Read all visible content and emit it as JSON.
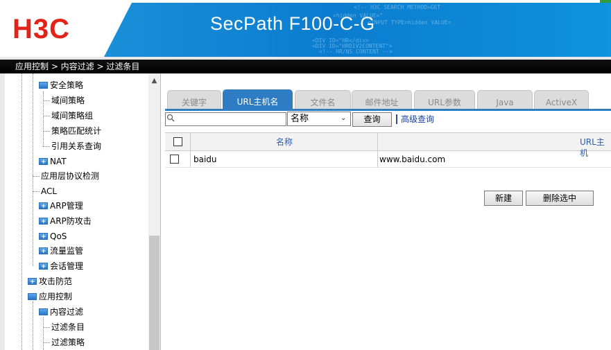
{
  "header": {
    "logo": "H3C",
    "product_title": "SecPath F100-C-G",
    "banner_code": [
      "<!-- H3C SEARCH METHOD=GET",
      "=hidden VALUE=\"",
      "<INPUT TYPE=hidden VALUE=",
      "<DIV ID=\"HR</div>",
      "<DIV ID=\"HRDIV2CONTENT\">",
      "<!-- HR/NS CONTENT -->"
    ]
  },
  "breadcrumb": "应用控制 > 内容过滤 > 过滤条目",
  "sidebar": {
    "items": [
      {
        "label": "安全策略",
        "icon": "folder-open-icon"
      },
      {
        "label": "域间策略",
        "icon": ""
      },
      {
        "label": "域间策略组",
        "icon": ""
      },
      {
        "label": "策略匹配统计",
        "icon": ""
      },
      {
        "label": "引用关系查询",
        "icon": ""
      },
      {
        "label": "NAT",
        "icon": "folder-plus-icon"
      },
      {
        "label": "应用层协议检测",
        "icon": ""
      },
      {
        "label": "ACL",
        "icon": ""
      },
      {
        "label": "ARP管理",
        "icon": "folder-plus-icon"
      },
      {
        "label": "ARP防攻击",
        "icon": "folder-plus-icon"
      },
      {
        "label": "QoS",
        "icon": "folder-plus-icon"
      },
      {
        "label": "流量监管",
        "icon": "folder-plus-icon"
      },
      {
        "label": "会话管理",
        "icon": "folder-plus-icon"
      },
      {
        "label": "攻击防范",
        "icon": "folder-plus-icon"
      },
      {
        "label": "应用控制",
        "icon": "folder-open-icon"
      },
      {
        "label": "内容过滤",
        "icon": "folder-open-icon"
      },
      {
        "label": "过滤条目",
        "icon": ""
      },
      {
        "label": "过滤策略",
        "icon": ""
      }
    ]
  },
  "tabs": [
    {
      "label": "关键字"
    },
    {
      "label": "URL主机名"
    },
    {
      "label": "文件名"
    },
    {
      "label": "邮件地址"
    },
    {
      "label": "URL参数"
    },
    {
      "label": "Java"
    },
    {
      "label": "ActiveX"
    }
  ],
  "search": {
    "placeholder": "",
    "field_select": "名称",
    "query_button": "查询",
    "advanced_link": "高级查询"
  },
  "table": {
    "columns": [
      "名称",
      "URL主机"
    ],
    "rows": [
      {
        "name": "baidu",
        "url_host": "www.baidu.com"
      }
    ]
  },
  "actions": {
    "new_button": "新建",
    "delete_selected_button": "删除选中"
  },
  "colors": {
    "brand_red": "#e2231a",
    "banner_blue": "#0b7ccf",
    "tab_active": "#2d7cc4",
    "link": "#1a3fa0"
  }
}
